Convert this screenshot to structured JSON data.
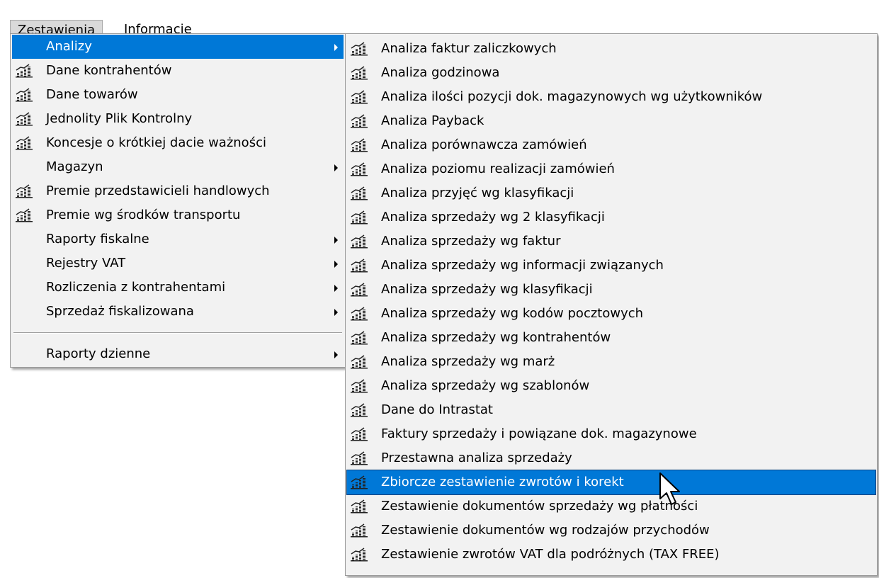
{
  "menubar": {
    "items": [
      "Zestawienia",
      "Informacje"
    ]
  },
  "menu1": {
    "items": [
      {
        "label": "Analizy",
        "icon": false,
        "submenu": true,
        "selected": true
      },
      {
        "label": "Dane kontrahentów",
        "icon": true,
        "submenu": false
      },
      {
        "label": "Dane towarów",
        "icon": true,
        "submenu": false
      },
      {
        "label": "Jednolity Plik Kontrolny",
        "icon": true,
        "submenu": false
      },
      {
        "label": "Koncesje o krótkiej dacie ważności",
        "icon": true,
        "submenu": false
      },
      {
        "label": "Magazyn",
        "icon": false,
        "submenu": true
      },
      {
        "label": "Premie przedstawicieli handlowych",
        "icon": true,
        "submenu": false
      },
      {
        "label": "Premie wg środków transportu",
        "icon": true,
        "submenu": false
      },
      {
        "label": "Raporty fiskalne",
        "icon": false,
        "submenu": true
      },
      {
        "label": "Rejestry VAT",
        "icon": false,
        "submenu": true
      },
      {
        "label": "Rozliczenia z kontrahentami",
        "icon": false,
        "submenu": true
      },
      {
        "label": "Sprzedaż fiskalizowana",
        "icon": false,
        "submenu": true
      }
    ],
    "after_separator": {
      "label": "Raporty dzienne",
      "icon": false,
      "submenu": true
    }
  },
  "menu2": {
    "items": [
      "Analiza faktur zaliczkowych",
      "Analiza godzinowa",
      "Analiza ilości pozycji dok. magazynowych wg użytkowników",
      "Analiza Payback",
      "Analiza porównawcza zamówień",
      "Analiza poziomu realizacji zamówień",
      "Analiza przyjęć wg klasyfikacji",
      "Analiza sprzedaży wg 2 klasyfikacji",
      "Analiza sprzedaży wg faktur",
      "Analiza sprzedaży wg informacji związanych",
      "Analiza sprzedaży wg klasyfikacji",
      "Analiza sprzedaży wg kodów pocztowych",
      "Analiza sprzedaży wg kontrahentów",
      "Analiza sprzedaży wg marż",
      "Analiza sprzedaży wg szablonów",
      "Dane do Intrastat",
      "Faktury sprzedaży i powiązane dok. magazynowe",
      "Przestawna analiza sprzedaży",
      "Zbiorcze zestawienie zwrotów i korekt",
      "Zestawienie dokumentów sprzedaży wg płatności",
      "Zestawienie dokumentów wg rodzajów przychodów",
      "Zestawienie zwrotów VAT dla podróżnych (TAX FREE)"
    ],
    "selected_index": 18
  },
  "colors": {
    "highlight": "#0078d7",
    "menu_bg": "#f2f2f2"
  },
  "icons": {
    "report": "chart-bars-icon",
    "submenu": "chevron-right-icon"
  }
}
